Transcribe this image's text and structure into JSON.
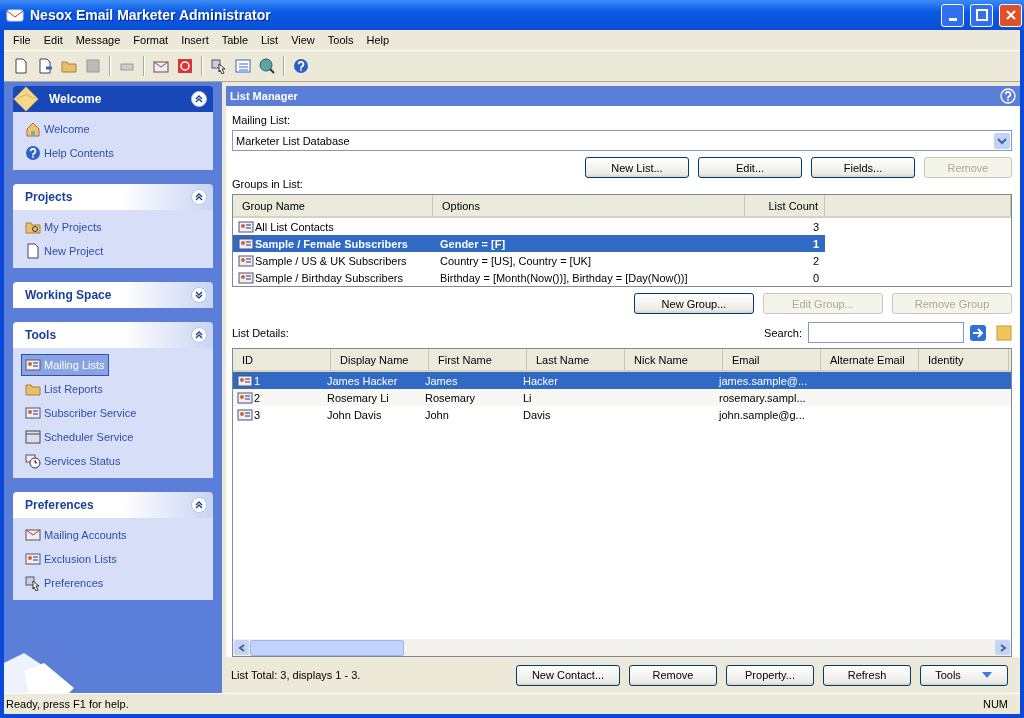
{
  "window": {
    "title": "Nesox Email Marketer Administrator"
  },
  "menu": [
    "File",
    "Edit",
    "Message",
    "Format",
    "Insert",
    "Table",
    "List",
    "View",
    "Tools",
    "Help"
  ],
  "sidebar": {
    "sections": [
      {
        "title": "Welcome",
        "kind": "banner",
        "expanded": true,
        "items": [
          {
            "label": "Welcome",
            "selected": false
          },
          {
            "label": "Help Contents",
            "selected": false
          }
        ]
      },
      {
        "title": "Projects",
        "kind": "plain",
        "expanded": true,
        "items": [
          {
            "label": "My Projects",
            "selected": false
          },
          {
            "label": "New Project",
            "selected": false
          }
        ]
      },
      {
        "title": "Working Space",
        "kind": "plain",
        "expanded": false
      },
      {
        "title": "Tools",
        "kind": "plain",
        "expanded": true,
        "items": [
          {
            "label": "Mailing Lists",
            "selected": true
          },
          {
            "label": "List Reports",
            "selected": false
          },
          {
            "label": "Subscriber Service",
            "selected": false
          },
          {
            "label": "Scheduler Service",
            "selected": false
          },
          {
            "label": "Services Status",
            "selected": false
          }
        ]
      },
      {
        "title": "Preferences",
        "kind": "plain",
        "expanded": true,
        "items": [
          {
            "label": "Mailing Accounts",
            "selected": false
          },
          {
            "label": "Exclusion Lists",
            "selected": false
          },
          {
            "label": "Preferences",
            "selected": false
          }
        ]
      }
    ]
  },
  "panel": {
    "title": "List Manager",
    "mailing_list": {
      "label": "Mailing List:",
      "value": "Marketer List Database"
    },
    "list_buttons": [
      {
        "label": "New List...",
        "disabled": false
      },
      {
        "label": "Edit...",
        "disabled": false
      },
      {
        "label": "Fields...",
        "disabled": false
      },
      {
        "label": "Remove",
        "disabled": true
      }
    ],
    "groups_label": "Groups in List:",
    "groups": {
      "columns": [
        "Group Name",
        "Options",
        "List Count"
      ],
      "rows": [
        {
          "name": "All List Contacts",
          "options": "",
          "count": "3",
          "selected": false
        },
        {
          "name": "Sample / Female Subscribers",
          "options": "Gender = [F]",
          "count": "1",
          "selected": true
        },
        {
          "name": "Sample / US & UK Subscribers",
          "options": "Country = [US], Country = [UK]",
          "count": "2",
          "selected": false
        },
        {
          "name": "Sample / Birthday Subscribers",
          "options": "Birthday = [Month(Now())], Birthday = [Day(Now())]",
          "count": "0",
          "selected": false
        }
      ]
    },
    "group_buttons": [
      {
        "label": "New Group...",
        "disabled": false
      },
      {
        "label": "Edit Group...",
        "disabled": true
      },
      {
        "label": "Remove Group",
        "disabled": true
      }
    ],
    "details_label": "List Details:",
    "search": {
      "label": "Search:"
    },
    "contacts": {
      "columns": [
        "ID",
        "Display Name",
        "First Name",
        "Last Name",
        "Nick Name",
        "Email",
        "Alternate Email",
        "Identity"
      ],
      "rows": [
        {
          "cells": [
            "1",
            "James Hacker",
            "James",
            "Hacker",
            "",
            "james.sample@...",
            "",
            ""
          ],
          "selected": true
        },
        {
          "cells": [
            "2",
            "Rosemary Li",
            "Rosemary",
            "Li",
            "",
            "rosemary.sampl...",
            "",
            ""
          ],
          "selected": false
        },
        {
          "cells": [
            "3",
            "John Davis",
            "John",
            "Davis",
            "",
            "john.sample@g...",
            "",
            ""
          ],
          "selected": false
        }
      ]
    },
    "total": "List Total: 3, displays 1 - 3.",
    "footer_buttons": [
      {
        "label": "New Contact...",
        "kind": "plain"
      },
      {
        "label": "Remove",
        "kind": "plain"
      },
      {
        "label": "Property...",
        "kind": "plain"
      },
      {
        "label": "Refresh",
        "kind": "plain"
      },
      {
        "label": "Tools",
        "kind": "dropdown"
      }
    ]
  },
  "status_bar": {
    "message": "Ready, press F1 for help.",
    "indicator": "NUM"
  }
}
